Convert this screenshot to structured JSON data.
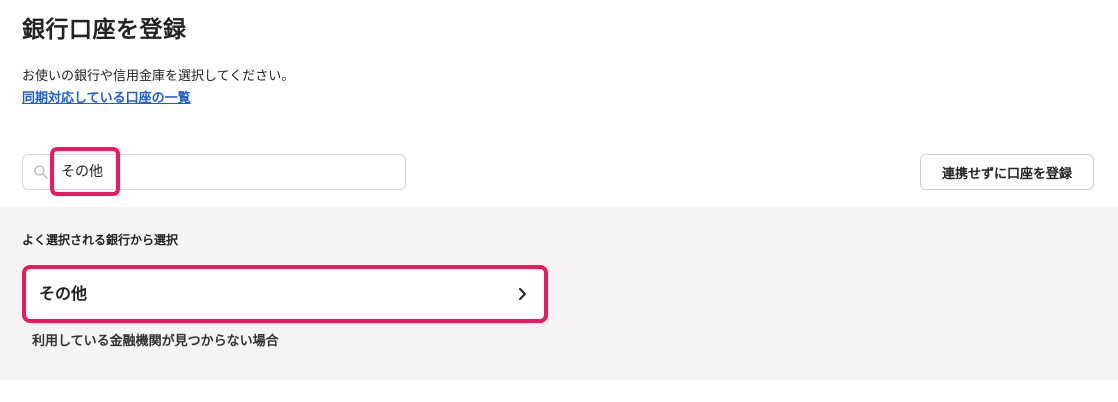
{
  "page": {
    "title": "銀行口座を登録",
    "description": "お使いの銀行や信用金庫を選択してください。",
    "supported_link": "同期対応している口座の一覧"
  },
  "search": {
    "icon": "search-icon",
    "value": "その他"
  },
  "register_without_sync_button": "連携せずに口座を登録",
  "suggestions": {
    "section_label": "よく選択される銀行から選択",
    "items": [
      {
        "name": "その他",
        "icon": "chevron-right-icon",
        "note": "利用している金融機関が見つからない場合"
      }
    ]
  },
  "colors": {
    "highlight": "#f0175e",
    "link": "#1f5fc7",
    "panel_background": "#f5f3f3",
    "text": "#222222"
  }
}
